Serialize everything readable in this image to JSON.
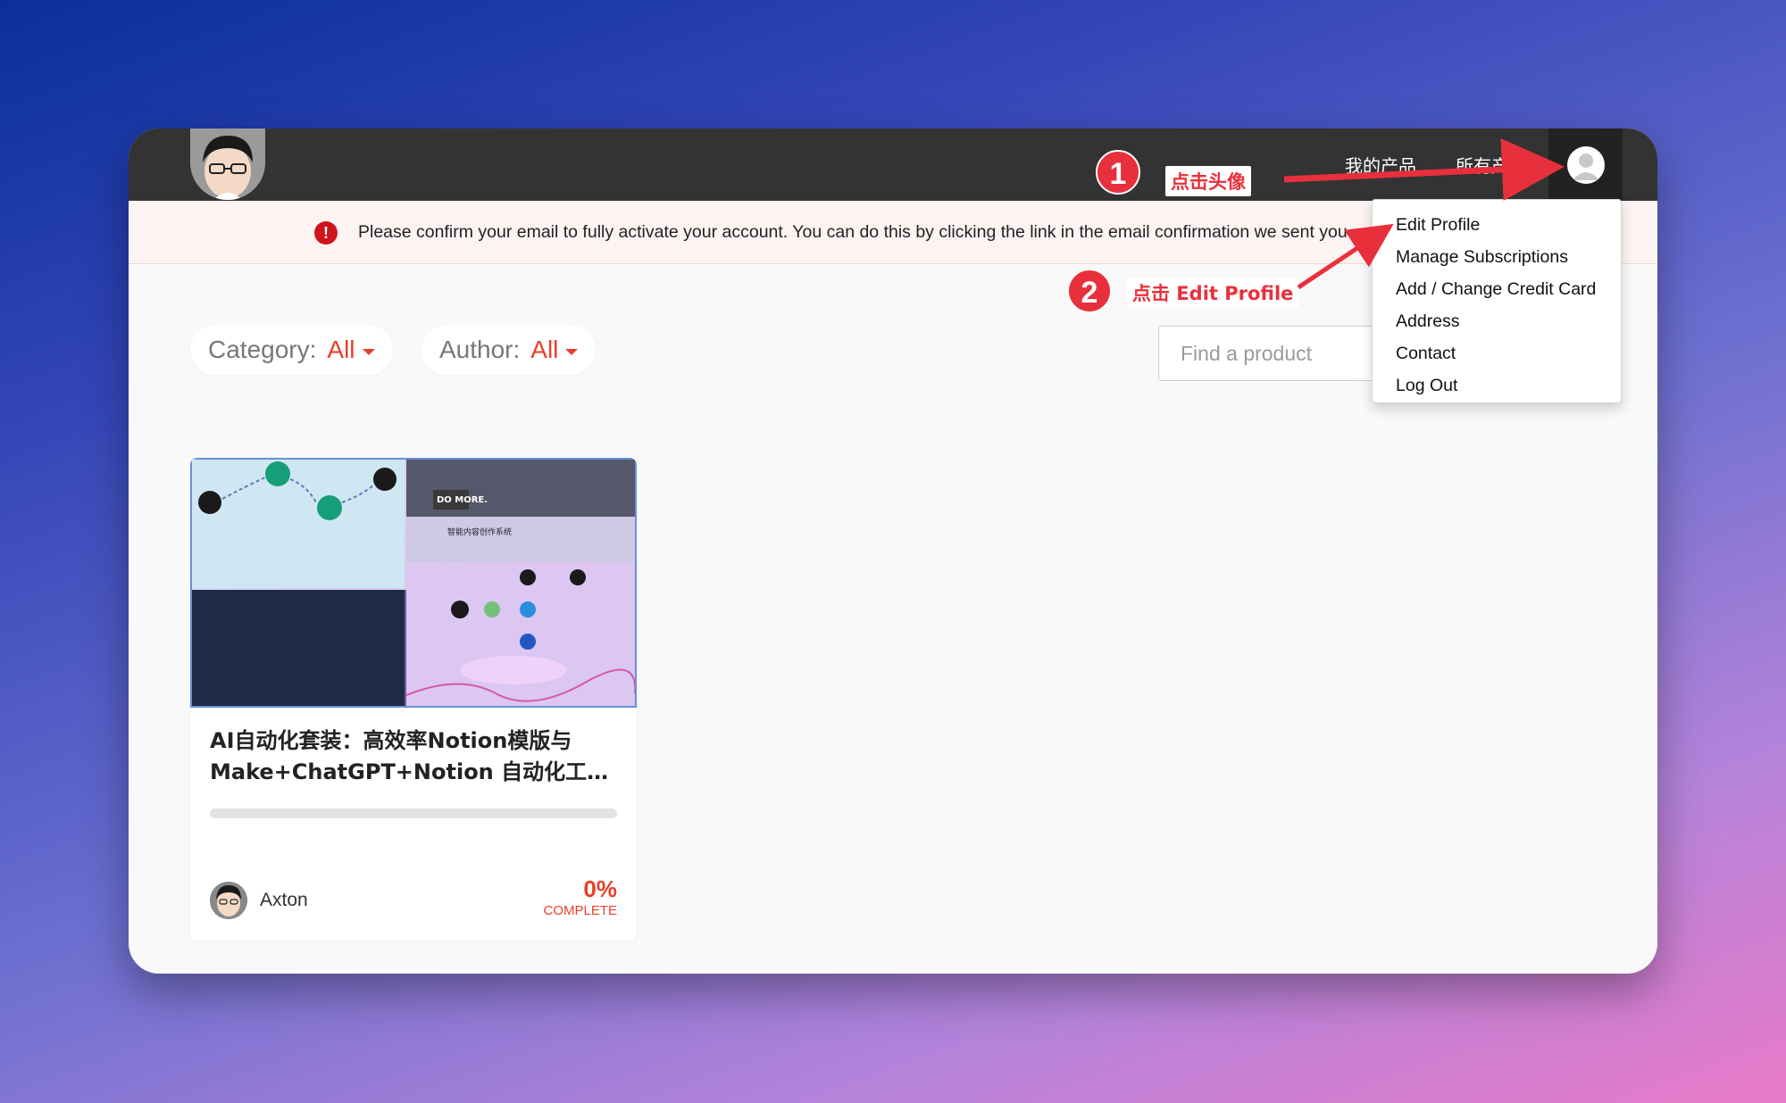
{
  "nav": {
    "links": [
      "我的产品",
      "所有产"
    ]
  },
  "alert": {
    "icon": "!",
    "message": "Please confirm your email to fully activate your account. You can do this by clicking the link in the email confirmation we sent you."
  },
  "filters": {
    "category_label": "Category:",
    "category_value": "All",
    "author_label": "Author:",
    "author_value": "All"
  },
  "search": {
    "placeholder": "Find a product"
  },
  "dropdown": {
    "items": [
      "Edit Profile",
      "Manage Subscriptions",
      "Add / Change Credit Card",
      "Address",
      "Contact",
      "Log Out"
    ]
  },
  "card": {
    "title_line1": "AI自动化套装：高效率Notion模版与",
    "title_line2": "Make+ChatGPT+Notion 自动化工作...",
    "progress": 0,
    "author": "Axton",
    "percent": "0%",
    "complete_label": "COMPLETE",
    "thumb_text1": "智能内容创作系统",
    "thumb_text2": "DO MORE."
  },
  "annotations": {
    "step1_number": "1",
    "step1_label": "点击头像",
    "step2_number": "2",
    "step2_label": "点击 Edit Profile",
    "arrow_color": "#e8303c"
  },
  "icons": {
    "alert": "exclamation-circle-icon",
    "caret": "caret-down-icon",
    "user": "user-avatar-icon"
  },
  "colors": {
    "accent": "#e8402a",
    "topbar": "#333333",
    "alert_bg": "#fdf3f3"
  }
}
